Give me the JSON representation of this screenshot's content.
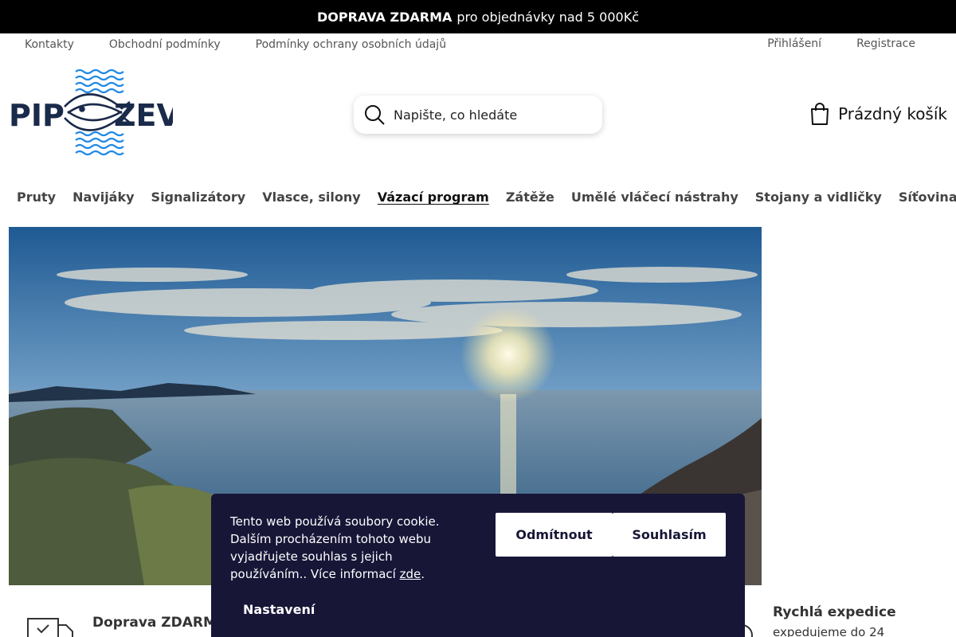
{
  "topbar": {
    "bold": "DOPRAVA ZDARMA",
    "text": "pro objednávky nad 5 000Kč"
  },
  "util": {
    "left_links": [
      "Kontakty",
      "Obchodní podmínky",
      "Podmínky ochrany osobních údajů"
    ],
    "login": "Přihlášení",
    "register": "Registrace"
  },
  "logo": {
    "left": "PIP",
    "right": "ZEVL",
    "accent": "#1e88e5"
  },
  "search": {
    "placeholder": "Napište, co hledáte"
  },
  "cart": {
    "label": "Prázdný košík"
  },
  "nav": {
    "items": [
      "Pruty",
      "Navijáky",
      "Signalizátory",
      "Vlasce, silony",
      "Vázací program",
      "Zátěže",
      "Umělé vláčecí nástrahy",
      "Stojany a vidličky",
      "Síťovina"
    ],
    "active": "Vázací program"
  },
  "benefits": {
    "shipping": {
      "title": "Doprava ZDARMA"
    },
    "expedition": {
      "title": "Rychlá expedice",
      "text": "expedujeme do 24"
    }
  },
  "cookie": {
    "text": "Tento web používá soubory cookie. Dalším procházením tohoto webu vyjadřujete souhlas s jejich používáním.. Více informací ",
    "link": "zde",
    "after": ".",
    "decline": "Odmítnout",
    "accept": "Souhlasím",
    "settings": "Nastavení"
  }
}
